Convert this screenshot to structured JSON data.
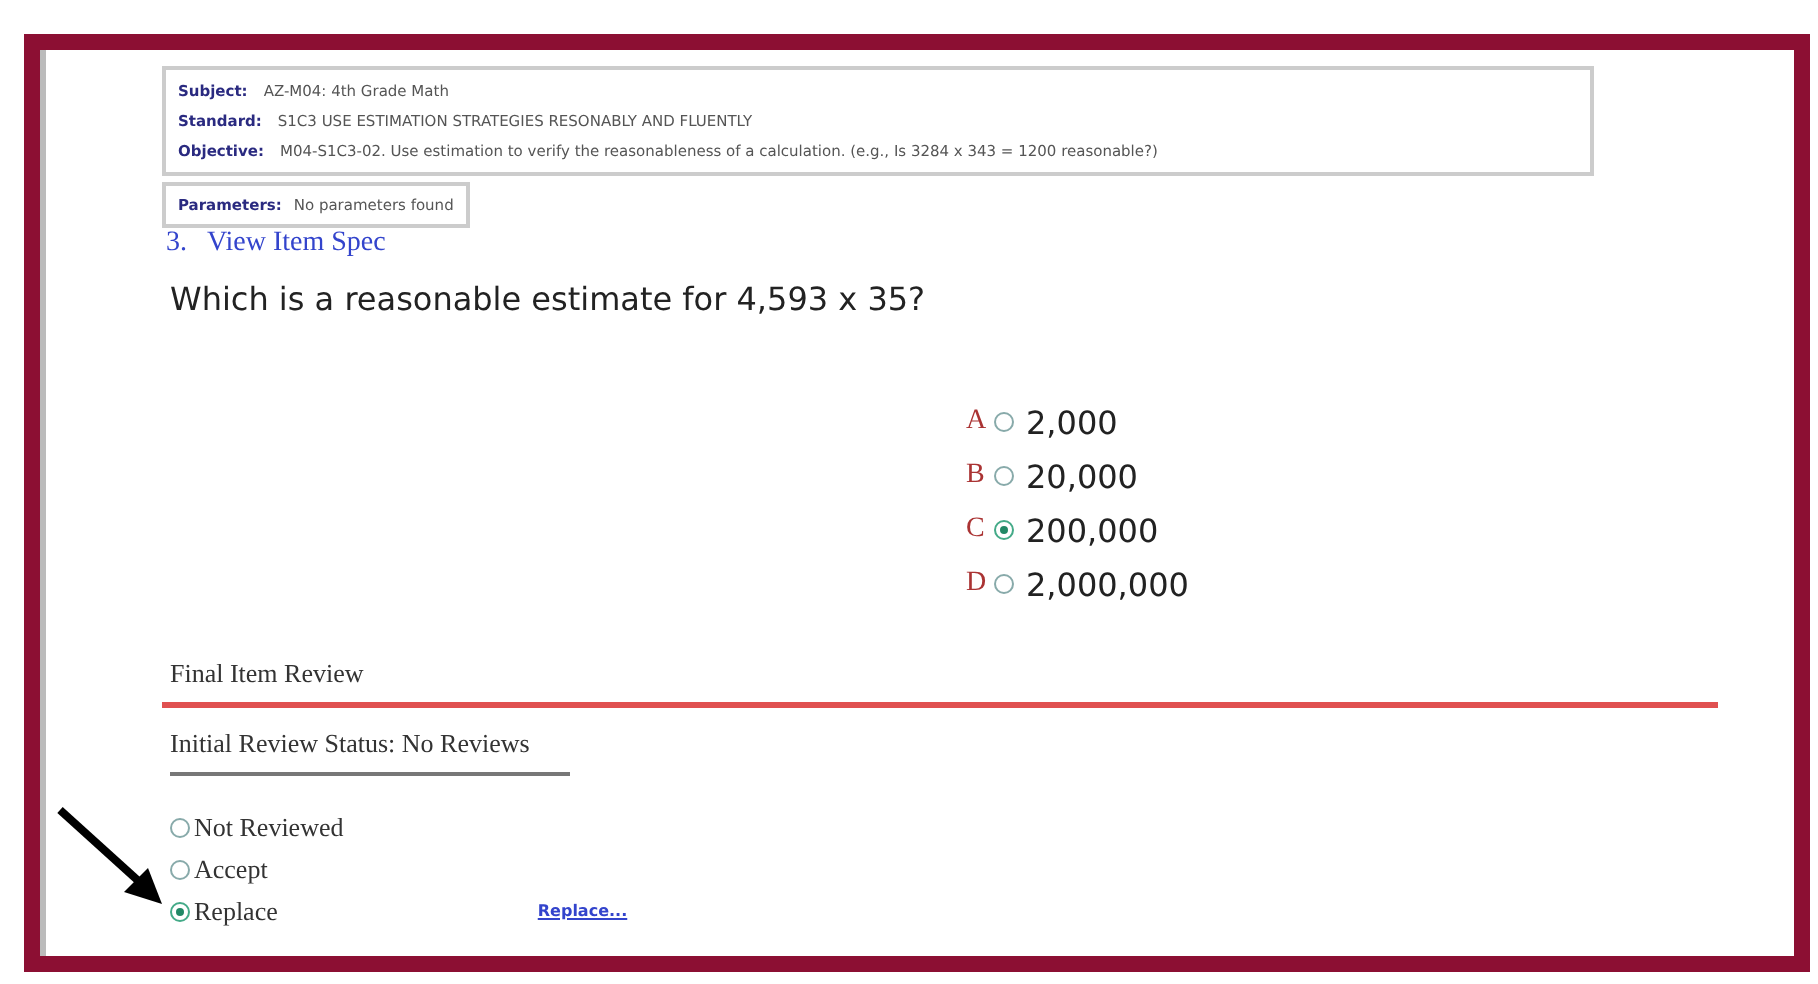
{
  "item_info": [
    {
      "label": "Subject:",
      "value": "AZ-M04: 4th Grade Math"
    },
    {
      "label": "Standard:",
      "value": "S1C3 USE ESTIMATION STRATEGIES RESONABLY AND FLUENTLY"
    },
    {
      "label": "Objective:",
      "value": "M04-S1C3-02. Use estimation to verify the reasonableness of a calculation. (e.g., Is 3284 x 343 = 1200 reasonable?)"
    }
  ],
  "parameters": {
    "label": "Parameters:",
    "value": "No parameters found"
  },
  "spec_link": {
    "number": "3.",
    "text": "View Item Spec"
  },
  "question": "Which is a reasonable estimate for 4,593 x 35?",
  "choices": [
    {
      "letter": "A",
      "text": "2,000",
      "selected": false
    },
    {
      "letter": "B",
      "text": "20,000",
      "selected": false
    },
    {
      "letter": "C",
      "text": "200,000",
      "selected": true
    },
    {
      "letter": "D",
      "text": "2,000,000",
      "selected": false
    }
  ],
  "final_review_heading": "Final Item Review",
  "initial_status": "Initial Review Status: No Reviews",
  "review_options": [
    {
      "label": "Not Reviewed",
      "selected": false
    },
    {
      "label": "Accept",
      "selected": false
    },
    {
      "label": "Replace",
      "selected": true
    }
  ],
  "replace_link": "Replace..."
}
